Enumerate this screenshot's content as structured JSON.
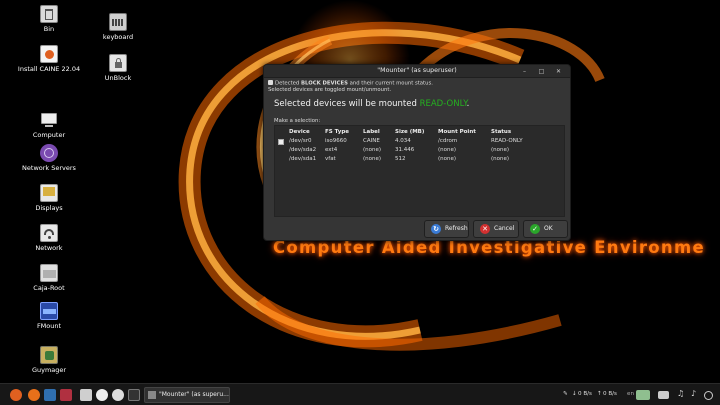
{
  "desktop": {
    "wallpaper_text": "Computer Aided Investigative Environme",
    "icons": [
      {
        "label": "Bin",
        "icon": "trash-bin-icon"
      },
      {
        "label": "keyboard",
        "icon": "keyboard-icon"
      },
      {
        "label": "Install CAINE 22.04",
        "icon": "installer-icon"
      },
      {
        "label": "UnBlock",
        "icon": "lock-icon"
      },
      {
        "label": "Computer",
        "icon": "computer-icon"
      },
      {
        "label": "Network Servers",
        "icon": "network-servers-icon"
      },
      {
        "label": "Displays",
        "icon": "displays-icon"
      },
      {
        "label": "Network",
        "icon": "network-icon"
      },
      {
        "label": "Caja-Root",
        "icon": "file-manager-icon"
      },
      {
        "label": "FMount",
        "icon": "fmount-icon"
      },
      {
        "label": "Guymager",
        "icon": "guymager-icon"
      }
    ]
  },
  "dialog": {
    "title": "\"Mounter\" (as superuser)",
    "info_prefix": "Detected ",
    "info_bold": "BLOCK DEVICES",
    "info_suffix": " and their current mount status.",
    "info_line2": "Selected devices are toggled mount/unmount.",
    "headline": "Selected devices will be mounted ",
    "headline_mode": "READ-ONLY",
    "headline_end": ".",
    "make_selection": "Make a selection:",
    "columns": [
      "Device",
      "FS Type",
      "Label",
      "Size (MB)",
      "Mount Point",
      "Status"
    ],
    "rows": [
      [
        "/dev/sr0",
        "iso9660",
        "CAINE",
        "4.034",
        "/cdrom",
        "READ-ONLY"
      ],
      [
        "/dev/sda2",
        "ext4",
        "(none)",
        "31.446",
        "(none)",
        "(none)"
      ],
      [
        "/dev/sda1",
        "vfat",
        "(none)",
        "512",
        "(none)",
        "(none)"
      ]
    ],
    "buttons": {
      "refresh": "Refresh",
      "cancel": "Cancel",
      "ok": "OK"
    }
  },
  "taskbar": {
    "task_label": "\"Mounter\" (as superu...",
    "net_down": "0 B/s",
    "net_up": "0 B/s",
    "keyboard_layout": "en"
  },
  "colors": {
    "accent_green": "#25b020",
    "wallpaper_orange": "#ff7a10",
    "cancel_red": "#d23030",
    "ok_green": "#2aa52a",
    "refresh_blue": "#3a7bd5"
  }
}
